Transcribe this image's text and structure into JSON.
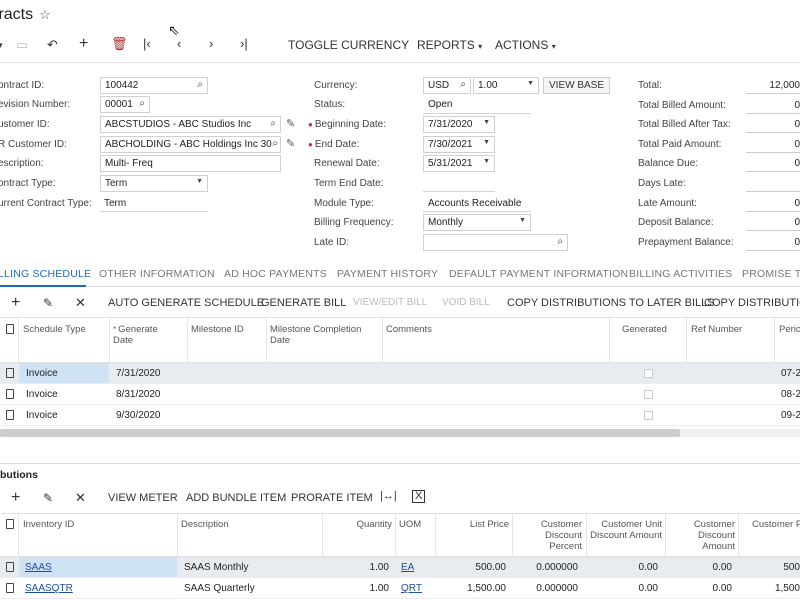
{
  "header": {
    "title": "tracts",
    "toggle_currency": "TOGGLE CURRENCY",
    "reports": "REPORTS",
    "actions": "ACTIONS"
  },
  "form": {
    "contract_id": {
      "label": "ontract ID:",
      "value": "100442"
    },
    "revision_number": {
      "label": "evision Number:",
      "value": "00001"
    },
    "customer_id": {
      "label": "ustomer ID:",
      "value": "ABCSTUDIOS - ABC Studios Inc"
    },
    "ar_customer_id": {
      "label": "R Customer ID:",
      "value": "ABCHOLDING - ABC Holdings Inc  30"
    },
    "description": {
      "label": "escription:",
      "value": "Multi- Freq"
    },
    "contract_type": {
      "label": "ontract Type:",
      "value": "Term"
    },
    "current_contract_type": {
      "label": "urrent Contract Type:",
      "value": "Term"
    },
    "currency": {
      "label": "Currency:",
      "value": "USD",
      "rate": "1.00",
      "view_base": "VIEW BASE"
    },
    "status": {
      "label": "Status:",
      "value": "Open"
    },
    "beginning_date": {
      "label": "Beginning Date:",
      "value": "7/31/2020"
    },
    "end_date": {
      "label": "End Date:",
      "value": "7/30/2021"
    },
    "renewal_date": {
      "label": "Renewal Date:",
      "value": "5/31/2021"
    },
    "term_end_date": {
      "label": "Term End Date:",
      "value": ""
    },
    "module_type": {
      "label": "Module Type:",
      "value": "Accounts Receivable"
    },
    "billing_frequency": {
      "label": "Billing Frequency:",
      "value": "Monthly"
    },
    "late_id": {
      "label": "Late ID:",
      "value": ""
    },
    "totals": [
      {
        "label": "Total:",
        "value": "12,000"
      },
      {
        "label": "Total Billed Amount:",
        "value": "0"
      },
      {
        "label": "Total Billed After Tax:",
        "value": "0"
      },
      {
        "label": "Total Paid Amount:",
        "value": "0"
      },
      {
        "label": "Balance Due:",
        "value": "0"
      },
      {
        "label": "Days Late:",
        "value": ""
      },
      {
        "label": "Late Amount:",
        "value": "0"
      },
      {
        "label": "Deposit Balance:",
        "value": "0"
      },
      {
        "label": "Prepayment Balance:",
        "value": "0"
      }
    ]
  },
  "tabs": [
    "LLING SCHEDULE",
    "OTHER INFORMATION",
    "AD HOC PAYMENTS",
    "PAYMENT HISTORY",
    "DEFAULT PAYMENT INFORMATION",
    "BILLING ACTIVITIES",
    "PROMISE TO"
  ],
  "schedule_toolbar": {
    "auto_generate": "AUTO GENERATE SCHEDULE",
    "generate_bill": "GENERATE BILL",
    "view_edit_bill": "VIEW/EDIT BILL",
    "void_bill": "VOID BILL",
    "copy_later": "COPY DISTRIBUTIONS TO LATER BILLS",
    "copy_dist": "COPY DISTRIBUTION"
  },
  "schedule_grid": {
    "headers": [
      "Schedule Type",
      "Generate Date",
      "Milestone ID",
      "Milestone Completion Date",
      "Comments",
      "Generated",
      "Ref Number",
      "Perio"
    ],
    "rows": [
      {
        "type": "Invoice",
        "date": "7/31/2020",
        "period": "07-2"
      },
      {
        "type": "Invoice",
        "date": "8/31/2020",
        "period": "08-2"
      },
      {
        "type": "Invoice",
        "date": "9/30/2020",
        "period": "09-2"
      }
    ]
  },
  "distributions": {
    "title": "butions",
    "toolbar": {
      "view_meter": "VIEW METER",
      "add_bundle": "ADD BUNDLE ITEM",
      "prorate": "PRORATE ITEM"
    },
    "headers": [
      "Inventory ID",
      "Description",
      "Quantity",
      "UOM",
      "List Price",
      "Customer Discount Percent",
      "Customer Unit Discount Amount",
      "Customer Discount Amount",
      "Customer P"
    ],
    "rows": [
      {
        "id": "SAAS",
        "desc": "SAAS Monthly",
        "qty": "1.00",
        "uom": "EA",
        "price": "500.00",
        "pct": "0.000000",
        "unit": "0.00",
        "amt": "0.00",
        "last": "500"
      },
      {
        "id": "SAASQTR",
        "desc": "SAAS Quarterly",
        "qty": "1.00",
        "uom": "QRT",
        "price": "1,500.00",
        "pct": "0.000000",
        "unit": "0.00",
        "amt": "0.00",
        "last": "1,500"
      }
    ]
  }
}
